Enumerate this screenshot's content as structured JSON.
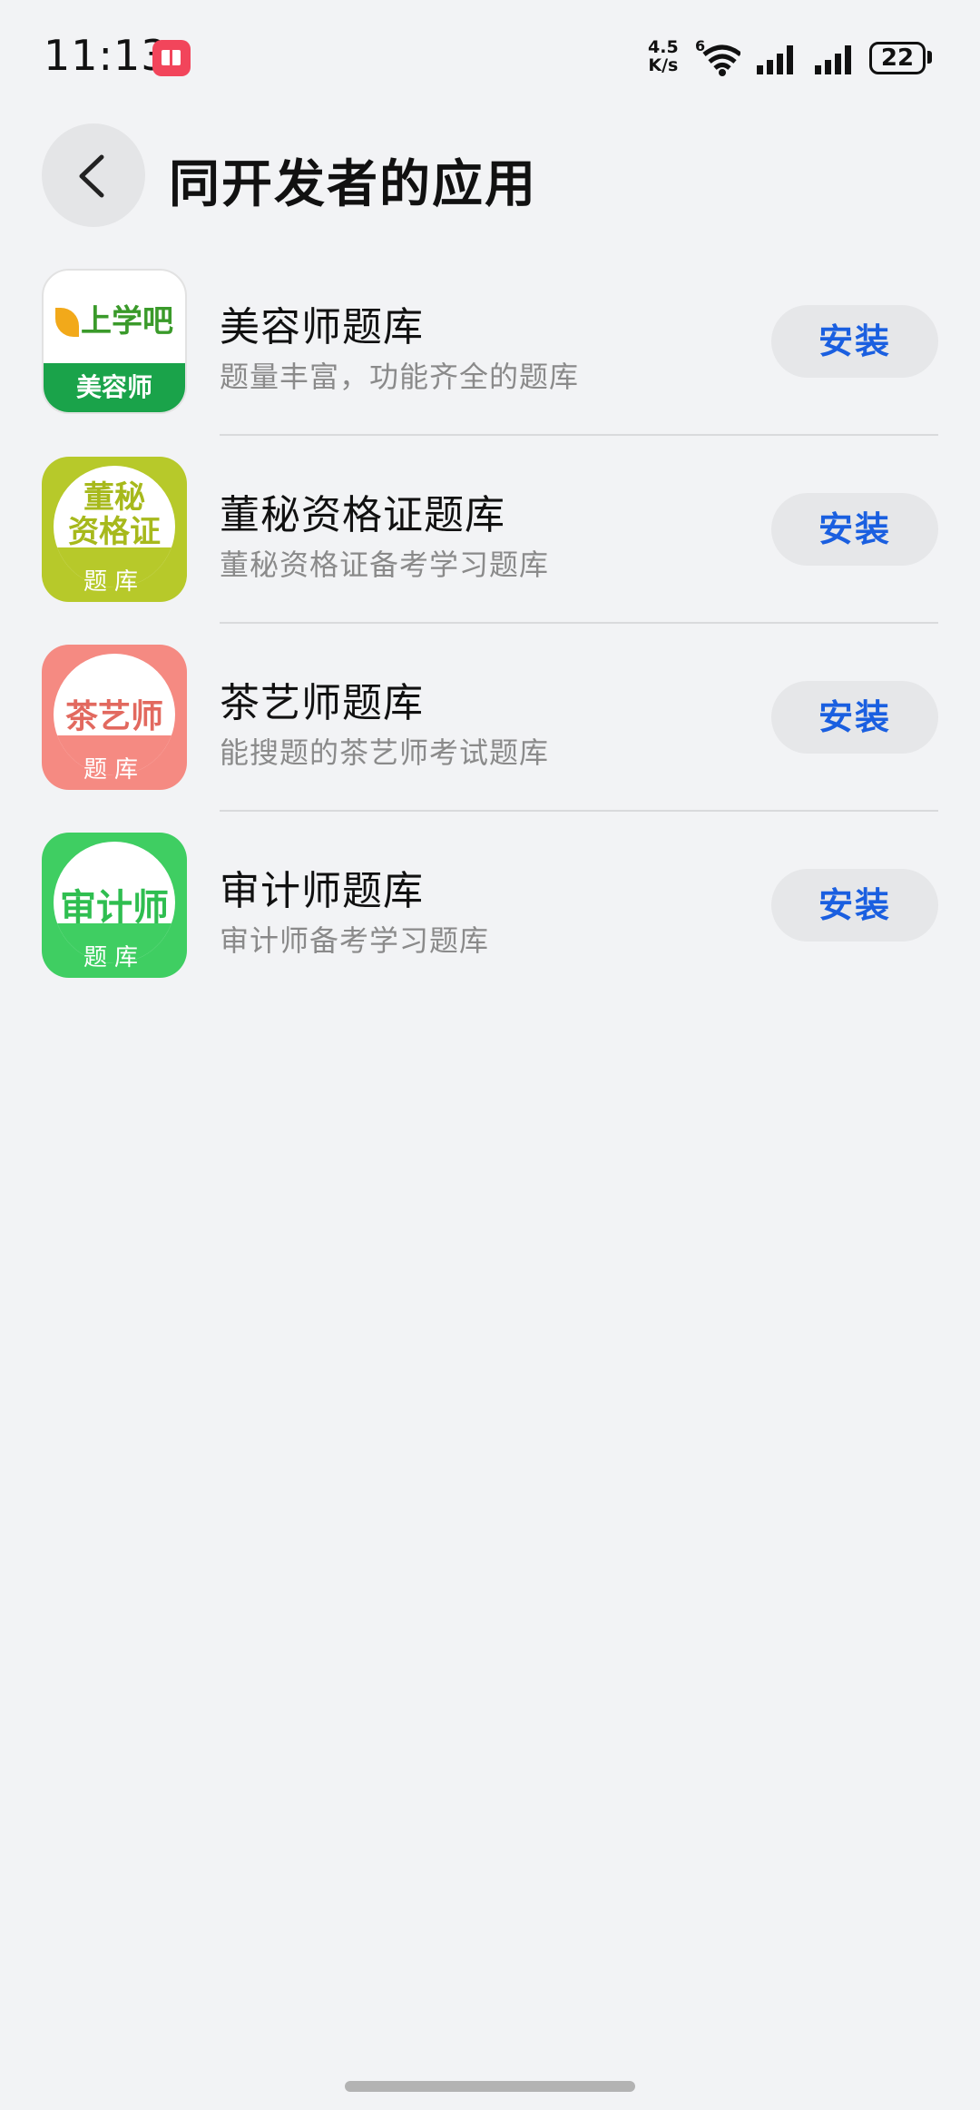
{
  "status_bar": {
    "time": "11:13",
    "net_speed_value": "4.5",
    "net_speed_unit": "K/s",
    "wifi_badge": "6",
    "battery": "22"
  },
  "header": {
    "title": "同开发者的应用"
  },
  "apps": [
    {
      "name": "美容师题库",
      "desc": "题量丰富，功能齐全的题库",
      "install_label": "安装",
      "icon": {
        "brand": "上学吧",
        "band_text": "美容师"
      }
    },
    {
      "name": "董秘资格证题库",
      "desc": "董秘资格证备考学习题库",
      "install_label": "安装",
      "icon": {
        "line1": "董秘",
        "line2": "资格证",
        "bottom": "题库"
      }
    },
    {
      "name": "茶艺师题库",
      "desc": "能搜题的茶艺师考试题库",
      "install_label": "安装",
      "icon": {
        "big": "茶艺师",
        "bottom": "题库"
      }
    },
    {
      "name": "审计师题库",
      "desc": "审计师备考学习题库",
      "install_label": "安装",
      "icon": {
        "big": "审计师",
        "bottom": "题库"
      }
    }
  ]
}
